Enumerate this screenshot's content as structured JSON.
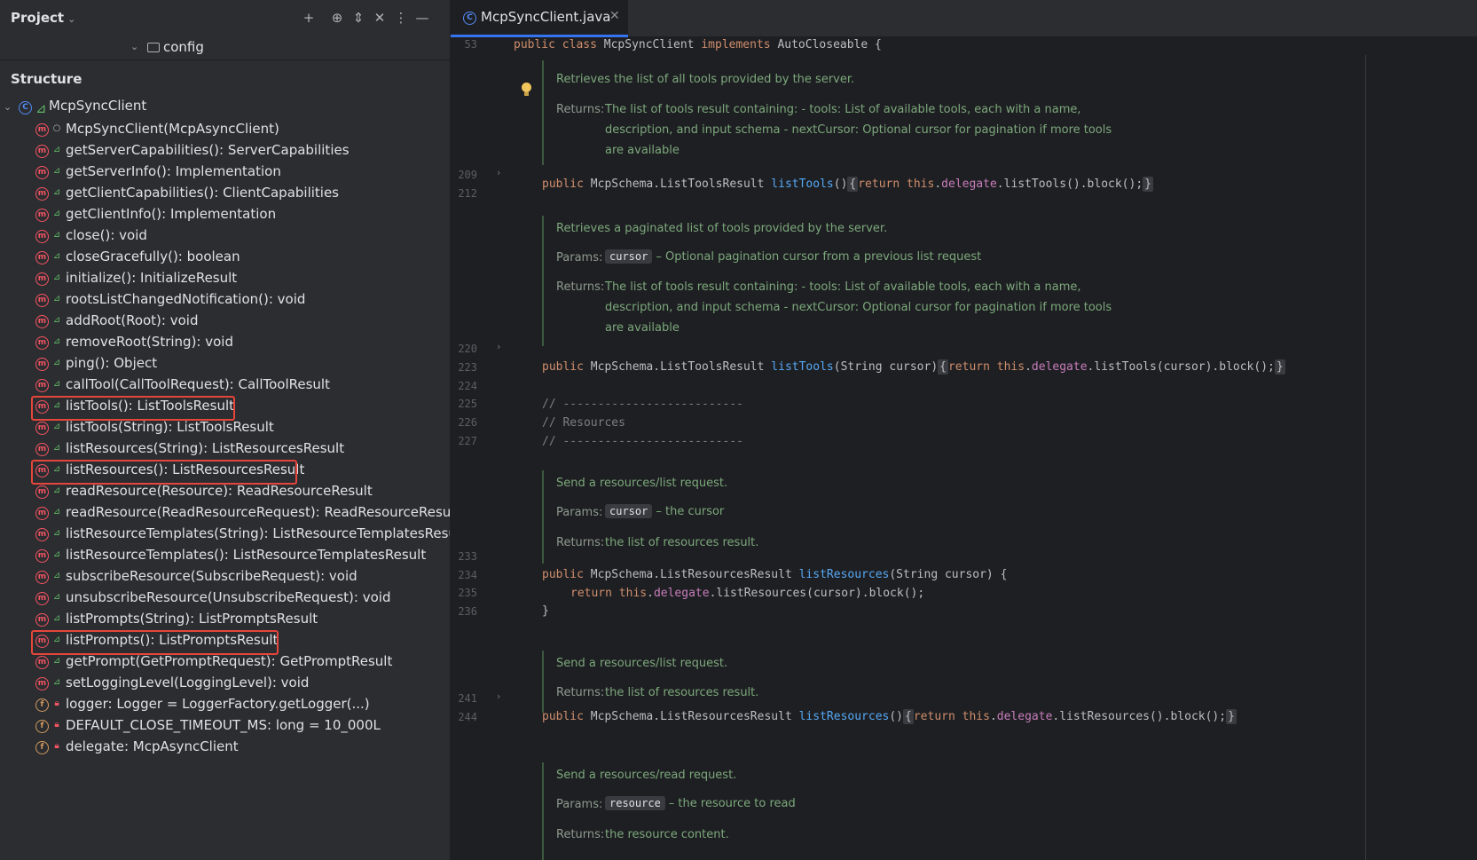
{
  "project_panel": {
    "title": "Project",
    "config_label": "config"
  },
  "structure": {
    "title": "Structure",
    "class_name": "McpSyncClient",
    "members": [
      {
        "label": "McpSyncClient(McpAsyncClient)",
        "kind": "method",
        "visibility": "package"
      },
      {
        "label": "getServerCapabilities(): ServerCapabilities",
        "kind": "method",
        "visibility": "public"
      },
      {
        "label": "getServerInfo(): Implementation",
        "kind": "method",
        "visibility": "public"
      },
      {
        "label": "getClientCapabilities(): ClientCapabilities",
        "kind": "method",
        "visibility": "public"
      },
      {
        "label": "getClientInfo(): Implementation",
        "kind": "method",
        "visibility": "public"
      },
      {
        "label": "close(): void",
        "kind": "method",
        "visibility": "public"
      },
      {
        "label": "closeGracefully(): boolean",
        "kind": "method",
        "visibility": "public"
      },
      {
        "label": "initialize(): InitializeResult",
        "kind": "method",
        "visibility": "public"
      },
      {
        "label": "rootsListChangedNotification(): void",
        "kind": "method",
        "visibility": "public"
      },
      {
        "label": "addRoot(Root): void",
        "kind": "method",
        "visibility": "public"
      },
      {
        "label": "removeRoot(String): void",
        "kind": "method",
        "visibility": "public"
      },
      {
        "label": "ping(): Object",
        "kind": "method",
        "visibility": "public"
      },
      {
        "label": "callTool(CallToolRequest): CallToolResult",
        "kind": "method",
        "visibility": "public"
      },
      {
        "label": "listTools(): ListToolsResult",
        "kind": "method",
        "visibility": "public",
        "highlighted": true
      },
      {
        "label": "listTools(String): ListToolsResult",
        "kind": "method",
        "visibility": "public"
      },
      {
        "label": "listResources(String): ListResourcesResult",
        "kind": "method",
        "visibility": "public"
      },
      {
        "label": "listResources(): ListResourcesResult",
        "kind": "method",
        "visibility": "public",
        "highlighted": true
      },
      {
        "label": "readResource(Resource): ReadResourceResult",
        "kind": "method",
        "visibility": "public"
      },
      {
        "label": "readResource(ReadResourceRequest): ReadResourceResult",
        "kind": "method",
        "visibility": "public"
      },
      {
        "label": "listResourceTemplates(String): ListResourceTemplatesResult",
        "kind": "method",
        "visibility": "public"
      },
      {
        "label": "listResourceTemplates(): ListResourceTemplatesResult",
        "kind": "method",
        "visibility": "public"
      },
      {
        "label": "subscribeResource(SubscribeRequest): void",
        "kind": "method",
        "visibility": "public"
      },
      {
        "label": "unsubscribeResource(UnsubscribeRequest): void",
        "kind": "method",
        "visibility": "public"
      },
      {
        "label": "listPrompts(String): ListPromptsResult",
        "kind": "method",
        "visibility": "public"
      },
      {
        "label": "listPrompts(): ListPromptsResult",
        "kind": "method",
        "visibility": "public",
        "highlighted": true
      },
      {
        "label": "getPrompt(GetPromptRequest): GetPromptResult",
        "kind": "method",
        "visibility": "public"
      },
      {
        "label": "setLoggingLevel(LoggingLevel): void",
        "kind": "method",
        "visibility": "public"
      },
      {
        "label": "logger: Logger = LoggerFactory.getLogger(...)",
        "kind": "field",
        "visibility": "private"
      },
      {
        "label": "DEFAULT_CLOSE_TIMEOUT_MS: long = 10_000L",
        "kind": "field",
        "visibility": "private"
      },
      {
        "label": "delegate: McpAsyncClient",
        "kind": "field",
        "visibility": "private"
      }
    ]
  },
  "editor": {
    "tab_label": "McpSyncClient.java",
    "line_numbers": {
      "l53": "53",
      "l209": "209",
      "l212": "212",
      "l220": "220",
      "l223": "223",
      "l224": "224",
      "l225": "225",
      "l226": "226",
      "l227": "227",
      "l233": "233",
      "l234": "234",
      "l235": "235",
      "l236": "236",
      "l241": "241",
      "l244": "244"
    },
    "code": {
      "l53_kw1": "public",
      "l53_kw2": "class",
      "l53_name": "McpSyncClient",
      "l53_kw3": "implements",
      "l53_rest": "AutoCloseable {",
      "l209_kw": "public",
      "l209_type": "McpSchema.ListToolsResult",
      "l209_fn": "listTools",
      "l209_params": "()",
      "l209_open": "{",
      "l209_kw2": "return",
      "l209_this": "this",
      "l209_field": "delegate",
      "l209_call": ".listTools().block();",
      "l209_close": "}",
      "l220_kw": "public",
      "l220_type": "McpSchema.ListToolsResult",
      "l220_fn": "listTools",
      "l220_params": "(String cursor)",
      "l220_open": "{",
      "l220_kw2": "return",
      "l220_this": "this",
      "l220_field": "delegate",
      "l220_call": ".listTools(cursor).block();",
      "l220_close": "}",
      "l224": "// --------------------------",
      "l225": "// Resources",
      "l226": "// --------------------------",
      "l233_kw": "public",
      "l233_type": "McpSchema.ListResourcesResult",
      "l233_fn": "listResources",
      "l233_params": "(String cursor) {",
      "l234_kw": "return",
      "l234_this": "this",
      "l234_field": "delegate",
      "l234_call": ".listResources(cursor).block();",
      "l235": "}",
      "l241_kw": "public",
      "l241_type": "McpSchema.ListResourcesResult",
      "l241_fn": "listResources",
      "l241_params": "()",
      "l241_open": "{",
      "l241_kw2": "return",
      "l241_this": "this",
      "l241_field": "delegate",
      "l241_call": ".listResources().block();",
      "l241_close": "}"
    },
    "docs": {
      "d1_summary": "Retrieves the list of all tools provided by the server.",
      "d1_returns_key": "Returns:",
      "d1_returns_1": "The list of tools result containing: - tools: List of available tools, each with a name,",
      "d1_returns_2": "description, and input schema - nextCursor: Optional cursor for pagination if more tools",
      "d1_returns_3": "are available",
      "d2_summary": "Retrieves a paginated list of tools provided by the server.",
      "d2_params_key": "Params:",
      "d2_param_chip": "cursor",
      "d2_param_desc": "– Optional pagination cursor from a previous list request",
      "d2_returns_key": "Returns:",
      "d2_returns_1": "The list of tools result containing: - tools: List of available tools, each with a name,",
      "d2_returns_2": "description, and input schema - nextCursor: Optional cursor for pagination if more tools",
      "d2_returns_3": "are available",
      "d3_summary": "Send a resources/list request.",
      "d3_params_key": "Params:",
      "d3_param_chip": "cursor",
      "d3_param_desc": "– the cursor",
      "d3_returns_key": "Returns:",
      "d3_returns": "the list of resources result.",
      "d4_summary": "Send a resources/list request.",
      "d4_returns_key": "Returns:",
      "d4_returns": "the list of resources result.",
      "d5_summary": "Send a resources/read request.",
      "d5_params_key": "Params:",
      "d5_param_chip": "resource",
      "d5_param_desc": "– the resource to read",
      "d5_returns_key": "Returns:",
      "d5_returns": "the resource content."
    }
  },
  "colors": {
    "highlight_border": "#e5453b",
    "method_icon": "#f75464",
    "class_icon": "#548af7",
    "keyword": "#cf8e6d",
    "function": "#56a8f5",
    "field": "#c77dbb",
    "doc_text": "#7ca87c"
  }
}
